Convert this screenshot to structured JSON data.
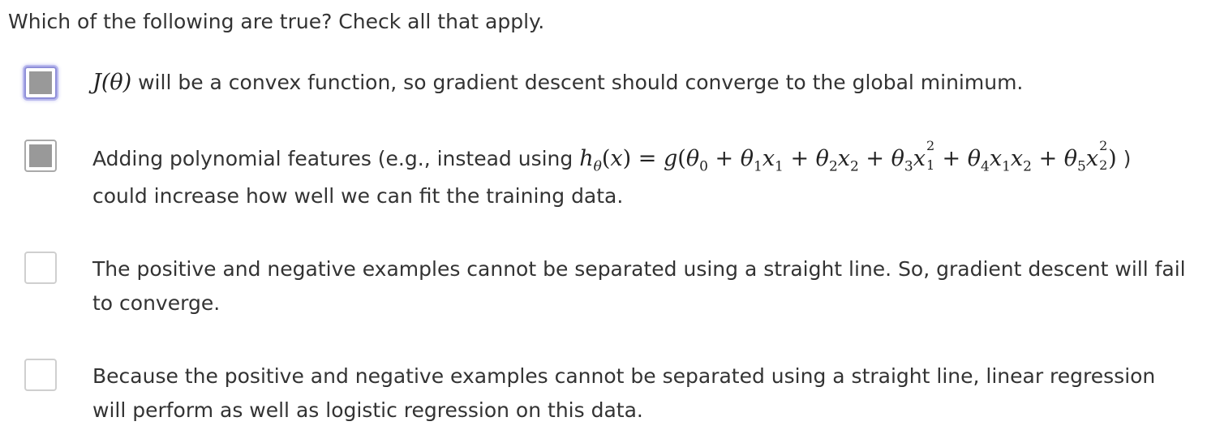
{
  "question": {
    "prompt": "Which of the following are true? Check all that apply."
  },
  "options": [
    {
      "checked": true,
      "focused": true,
      "math": "J(θ)",
      "text": " will be a convex function, so gradient descent should converge to the global minimum."
    },
    {
      "checked": true,
      "focused": false,
      "text_before": "Adding polynomial features (e.g., instead using ",
      "math_lhs": "hθ(x) =",
      "math_rhs": "g(θ0 + θ1x1 + θ2x2 + θ3x1² + θ4x1x2 + θ5x2²)",
      "text_after": " )",
      "line2": "could increase how well we can fit the training data."
    },
    {
      "checked": false,
      "focused": false,
      "line1": "The positive and negative examples cannot be separated using a straight line. So, gradient descent will fail",
      "line2": "to converge."
    },
    {
      "checked": false,
      "focused": false,
      "line1": "Because the positive and negative examples cannot be separated using a straight line, linear regression",
      "line2": "will perform as well as logistic regression on this data."
    }
  ],
  "colors": {
    "text": "#333333",
    "checkbox_fill": "#999999",
    "focus_ring": "#8f8fd8"
  }
}
